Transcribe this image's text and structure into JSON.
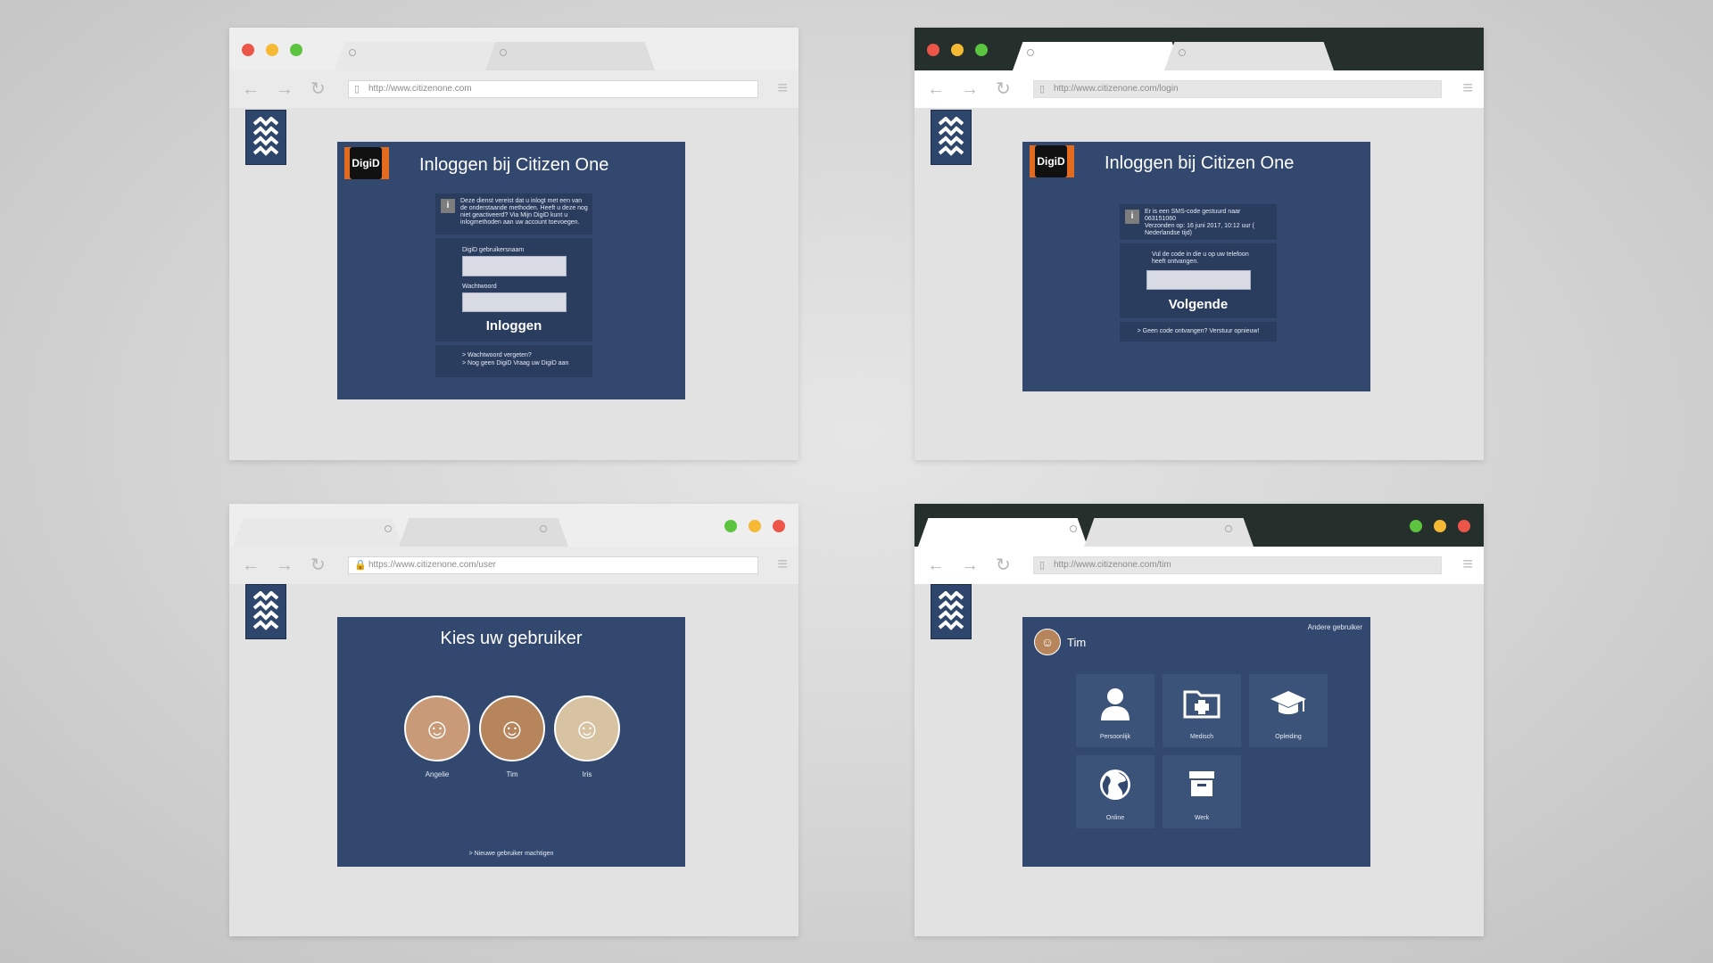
{
  "windows": [
    {
      "url": "http://www.citizenone.com",
      "panel_title": "Inloggen bij Citizen One",
      "info_text": "Deze dienst vereist dat u inlogt met een van de onderstaande methoden. Heeft u deze nog niet geactiveerd? Via Mijn DigiD kunt u inlogmethoden aan uw account toevoegen.",
      "username_label": "DigiD gebruikersnaam",
      "password_label": "Wachtwoord",
      "button": "Inloggen",
      "links": [
        "> Wachtwoord vergeten?",
        "> Nog geen DigiD Vraag uw DigiD aan"
      ]
    },
    {
      "url": "http://www.citizenone.com/login",
      "panel_title": "Inloggen bij Citizen One",
      "info_text": "Er is een SMS-code gestuurd naar 063151060",
      "info_sent": "Verzonden op: 16 juni 2017, 10:12 uur ( Nederlandse tijd)",
      "code_label": "Vul de code in die u op uw telefoon heeft ontvangen.",
      "button": "Volgende",
      "resend": "> Geen code ontvangen? Verstuur opnieuw!"
    },
    {
      "url": "https://www.citizenone.com/user",
      "panel_title": "Kies uw gebruiker",
      "users": [
        "Angelie",
        "Tim",
        "Iris"
      ],
      "new_user": "> Nieuwe gebruiker machtigen"
    },
    {
      "url": "http://www.citizenone.com/tim",
      "user": "Tim",
      "switch_user": "Andere gebruiker",
      "tiles": [
        "Persoonlijk",
        "Medisch",
        "Opleiding",
        "Online",
        "Werk"
      ]
    }
  ],
  "digid": "DigiD",
  "icons": [
    "back-arrow-icon",
    "forward-arrow-icon",
    "reload-icon",
    "menu-icon",
    "user-icon",
    "medical-folder-icon",
    "graduation-cap-icon",
    "globe-icon",
    "archive-box-icon"
  ]
}
